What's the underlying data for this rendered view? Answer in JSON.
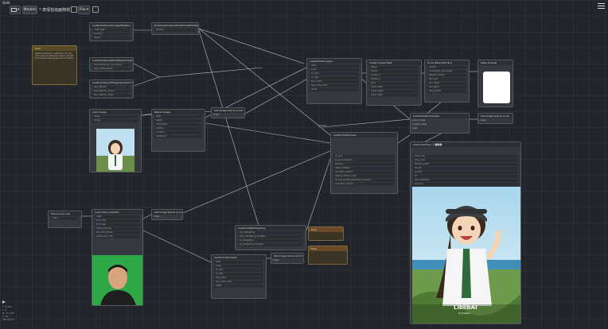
{
  "app": {
    "brand": "liblib"
  },
  "toolbar": {
    "workflow_button": "▾",
    "models_label": "Models",
    "workflow_name": "* 表情包动画特效",
    "file_label": "File ▾"
  },
  "nodes": {
    "note": {
      "title": "Note",
      "text": "Default workflow for LivePortrait. Connect video input and reference image to animate the character with expressions and motions."
    },
    "loader_pipeline": {
      "title": "LivePortraitLoadCropperPipeline",
      "rows": [
        "model_path",
        "precision",
        "device"
      ]
    },
    "face_detect": {
      "title": "LivePortraitLoadMediaPipeCropper",
      "rows": [
        "landmarkrunner_onnx_device",
        "keep_model_loaded"
      ]
    },
    "face_crop": {
      "title": "LivePortraitLoadFaceAlignmentCropper",
      "rows": [
        "face_detector",
        "face_detector_device",
        "face_detector_dtype"
      ]
    },
    "download": {
      "title": "DownloadAndLoadLivePortraitModels",
      "rows": [
        "precision"
      ]
    },
    "load_image": {
      "title": "Load Image",
      "rows": [
        "image",
        "upload"
      ]
    },
    "resize": {
      "title": "Resize Image",
      "rows": [
        "width",
        "height",
        "interpolation",
        "method",
        "condition",
        "multiple_of"
      ]
    },
    "get_size1": {
      "title": "Get Image Size & Count",
      "rows": [
        "image"
      ]
    },
    "get_size2": {
      "title": "Get Image Size & Count",
      "rows": [
        "image"
      ]
    },
    "get_size3": {
      "title": "Get Image Size & Count",
      "rows": [
        "image"
      ]
    },
    "get_size4": {
      "title": "Get Image Size & Count",
      "rows": [
        "image"
      ]
    },
    "cropper1": {
      "title": "LivePortraitCropper",
      "rows": [
        "dsize",
        "scale",
        "vx_ratio",
        "vy_ratio",
        "face_index",
        "face_index_order",
        "rotate"
      ]
    },
    "create_mask": {
      "title": "Create Shape Mask",
      "rows": [
        "shape",
        "frames",
        "location_x",
        "location_y",
        "grow",
        "frame_width",
        "frame_height",
        "shape_width",
        "shape_height"
      ]
    },
    "grow_mask": {
      "title": "Grow Mask With Blur",
      "rows": [
        "expand",
        "incremental_expandrate",
        "tapered_corners",
        "flip_input",
        "blur_radius",
        "lerp_alpha",
        "decay_factor"
      ]
    },
    "mask_preview": {
      "title": "Mask Preview"
    },
    "composite": {
      "title": "LivePortraitComposite",
      "rows": [
        "source_image",
        "cropped_image",
        "liveportrait_out",
        "mask"
      ]
    },
    "process": {
      "title": "LivePortraitProcess",
      "rows": [
        "lip_zero",
        "lip_zero_threshold",
        "stitching",
        "delta_multiplier",
        "mismatch_method",
        "relative_motion_mode",
        "driving_smooth_observation_variance",
        "expression_friendly",
        "expression_friendly_multiplier"
      ]
    },
    "video_combine": {
      "title": "Video Combine 🎥🅥🅗🅢",
      "rows": [
        "frame_rate",
        "loop_count",
        "filename_prefix",
        "format",
        "pix_fmt",
        "crf",
        "save_metadata",
        "pingpong",
        "save_output"
      ]
    },
    "frame_load_cap": {
      "title": "frame_load_cap",
      "rows": [
        "value"
      ]
    },
    "load_video": {
      "title": "Load Video (Upload)",
      "rows": [
        "video",
        "force_rate",
        "force_size",
        "frame_load_cap",
        "skip_first_frames",
        "select_every_nth"
      ]
    },
    "retargeting": {
      "title": "LivePortraitRetargeting",
      "rows": [
        "eye_retargeting",
        "eyes_retargeting_multiplier",
        "lip_retargeting",
        "lip_retargeting_multiplier"
      ]
    },
    "cropper2": {
      "title": "LivePortraitCropper",
      "rows": [
        "dsize",
        "scale",
        "vx_ratio",
        "vy_ratio",
        "face_index",
        "face_index_order",
        "rotate"
      ]
    },
    "note2": {
      "title": "Note"
    },
    "note3": {
      "title": "Note"
    }
  },
  "watermark": {
    "text": "LiblibAI",
    "sub": "AI Creator"
  },
  "status": {
    "lines": [
      "T: 0.00s",
      "I: 0",
      "N: 31 [31]",
      "V: 62",
      "FPS:60.00"
    ]
  },
  "colors": {
    "bg": "#22262c",
    "node": "#35393f",
    "wire": "#e6e6e6"
  }
}
